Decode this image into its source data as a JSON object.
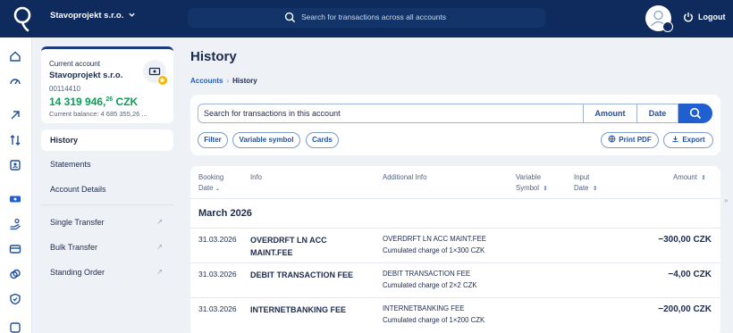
{
  "header": {
    "company": "Stavoprojekt s.r.o.",
    "search_placeholder": "Search for transactions across all accounts",
    "logout_label": "Logout"
  },
  "account": {
    "label": "Current account",
    "name": "Stavoprojekt s.r.o.",
    "number": "00114410",
    "balance_main": "14 319 946,",
    "balance_dec": "26",
    "currency": " CZK",
    "current_balance": "Current balance: 4 685 355,26 ..."
  },
  "sidebar": {
    "items": [
      {
        "label": "History"
      },
      {
        "label": "Statements"
      },
      {
        "label": "Account Details"
      },
      {
        "label": "Single Transfer"
      },
      {
        "label": "Bulk Transfer"
      },
      {
        "label": "Standing Order"
      }
    ]
  },
  "page": {
    "title": "History",
    "breadcrumb": [
      "Accounts",
      "History"
    ]
  },
  "search": {
    "placeholder": "Search for transactions in this account",
    "amount_label": "Amount",
    "date_label": "Date"
  },
  "filters": {
    "filter": "Filter",
    "variable_symbol": "Variable symbol",
    "cards": "Cards",
    "print_pdf": "Print PDF",
    "export": "Export"
  },
  "table": {
    "headers": {
      "booking_date_1": "Booking",
      "booking_date_2": "Date",
      "info": "Info",
      "additional_info": "Additional Info",
      "variable_symbol_1": "Variable",
      "variable_symbol_2": "Symbol",
      "input_date_1": "Input",
      "input_date_2": "Date",
      "amount": "Amount"
    },
    "month": "March 2026",
    "rows": [
      {
        "date": "31.03.2026",
        "info": "OVERDRFT LN ACC MAINT.FEE",
        "add1": "OVERDRFT LN ACC MAINT.FEE",
        "add2": "Cumulated charge of 1×300 CZK",
        "amount": "−300,00 CZK"
      },
      {
        "date": "31.03.2026",
        "info": "DEBIT TRANSACTION FEE",
        "add1": "DEBIT TRANSACTION FEE",
        "add2": "Cumulated charge of 2×2 CZK",
        "amount": "−4,00 CZK"
      },
      {
        "date": "31.03.2026",
        "info": "INTERNETBANKING FEE",
        "add1": "INTERNETBANKING FEE",
        "add2": "Cumulated charge of 1×200 CZK",
        "amount": "−200,00 CZK"
      }
    ]
  },
  "colors": {
    "header_bg": "#0f2a5c",
    "accent": "#1f5fd0",
    "balance_green": "#0f9a5a"
  }
}
